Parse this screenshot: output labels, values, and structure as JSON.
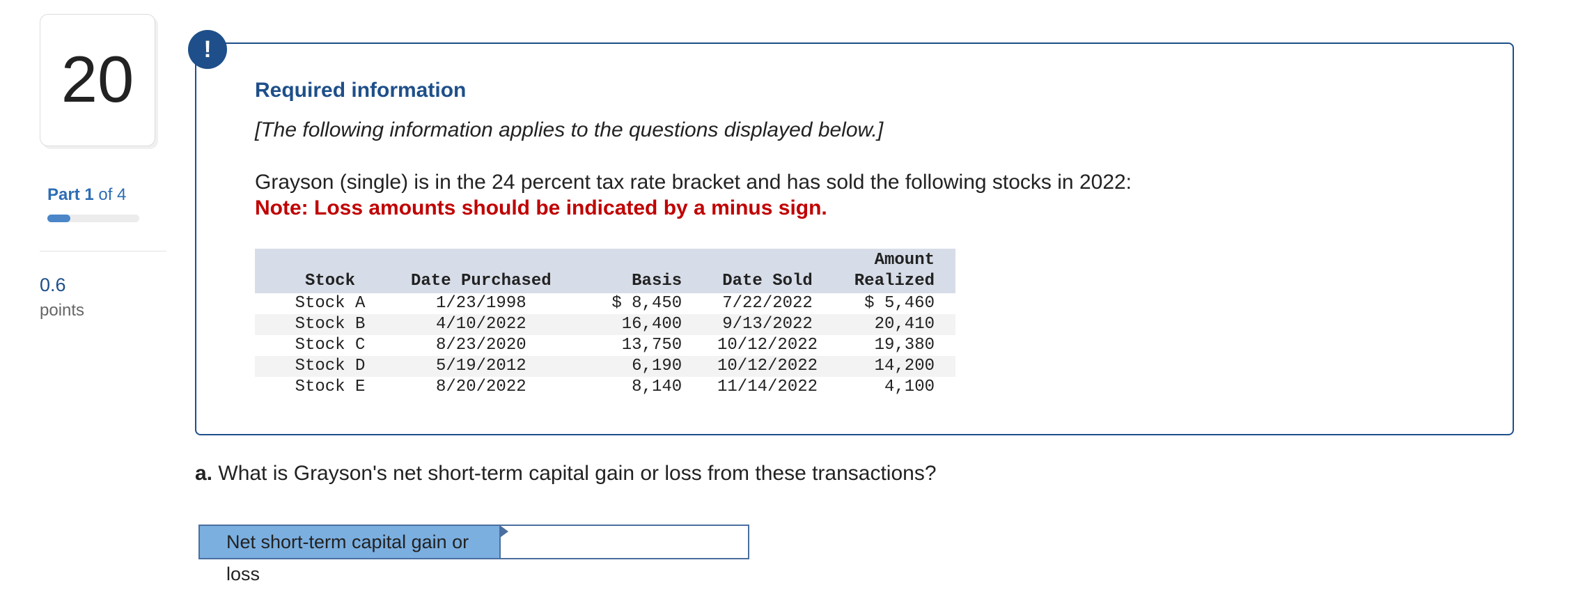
{
  "question": {
    "number": "20",
    "part_strong": "Part 1",
    "part_rest": "of 4",
    "progress": 0.25,
    "points_value": "0.6",
    "points_label": "points"
  },
  "info_box": {
    "alert_symbol": "!",
    "title": "Required information",
    "subtitle": "[The following information applies to the questions displayed below.]",
    "body": "Grayson (single) is in the 24 percent tax rate bracket and has sold the following stocks in 2022:",
    "note": "Note: Loss amounts should be indicated by a minus sign."
  },
  "table": {
    "headers": {
      "stock": "Stock",
      "date_purchased": "Date Purchased",
      "basis": "Basis",
      "date_sold": "Date Sold",
      "amount_line1": "Amount",
      "amount_line2": "Realized"
    },
    "rows": [
      {
        "stock": "Stock A",
        "date_purchased": "1/23/1998",
        "basis": "$ 8,450",
        "date_sold": "7/22/2022",
        "amount": "$ 5,460"
      },
      {
        "stock": "Stock B",
        "date_purchased": "4/10/2022",
        "basis": "16,400",
        "date_sold": "9/13/2022",
        "amount": "20,410"
      },
      {
        "stock": "Stock C",
        "date_purchased": "8/23/2020",
        "basis": "13,750",
        "date_sold": "10/12/2022",
        "amount": "19,380"
      },
      {
        "stock": "Stock D",
        "date_purchased": "5/19/2012",
        "basis": "6,190",
        "date_sold": "10/12/2022",
        "amount": "14,200"
      },
      {
        "stock": "Stock E",
        "date_purchased": "8/20/2022",
        "basis": "8,140",
        "date_sold": "11/14/2022",
        "amount": "4,100"
      }
    ]
  },
  "question_a": {
    "label": "a.",
    "text": "What is Grayson's net short-term capital gain or loss from these transactions?"
  },
  "answer": {
    "label": "Net short-term capital gain or loss",
    "value": ""
  },
  "colors": {
    "accent": "#1e4f8a",
    "note_red": "#c00000",
    "answer_label_bg": "#7bafe0",
    "table_header_bg": "#d7dde8"
  }
}
